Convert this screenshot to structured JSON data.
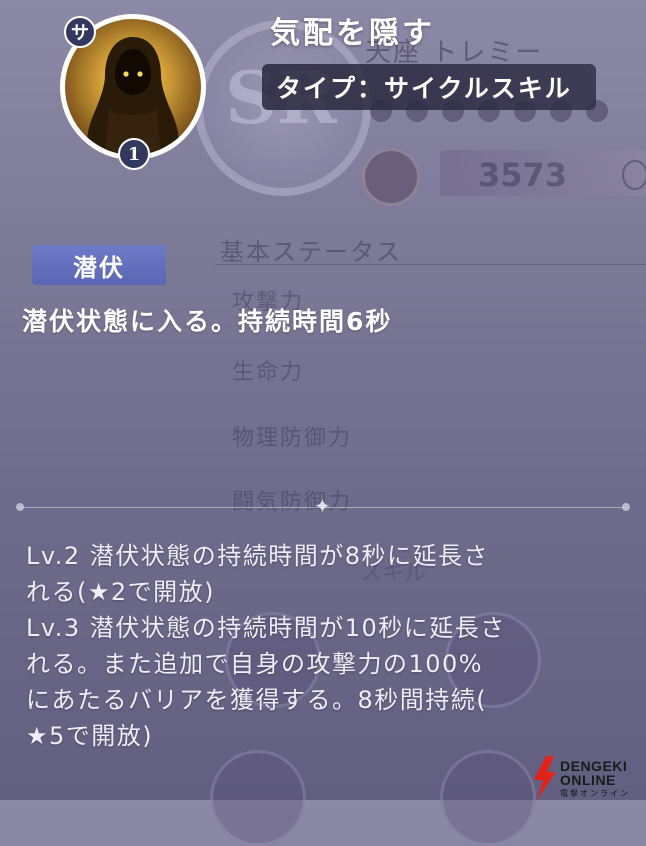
{
  "skill": {
    "title": "気配を隠す",
    "type_label": "タイプ：サイクルスキル",
    "type_badge": "サ",
    "level_badge": "1"
  },
  "effect": {
    "tag": "潜伏",
    "description": "潜伏状態に入る。持続時間6秒"
  },
  "level_bonuses": [
    "Lv.2 潜伏状態の持続時間が8秒に延長さ",
    "れる(★2で開放)",
    "Lv.3 潜伏状態の持続時間が10秒に延長さ",
    "れる。また追加で自身の攻撃力の100%",
    "にあたるバリアを獲得する。8秒間持続(",
    "★5で開放)"
  ],
  "background": {
    "character_name": "天座 トレミー",
    "emblem_letter": "SR",
    "power_value": "3573",
    "section_title": "基本ステータス",
    "stats": [
      "攻撃力",
      "生命力",
      "物理防御力",
      "闘気防御力"
    ],
    "skill_label": "スキル"
  },
  "watermark": {
    "line1": "DENGEKI",
    "line2": "ONLINE",
    "line3": "電撃オンライン"
  },
  "colors": {
    "tag_bg": "#6e7bc9",
    "type_bg": "#28263c",
    "badge_bg": "#33395e",
    "watermark_accent": "#e2231a"
  }
}
